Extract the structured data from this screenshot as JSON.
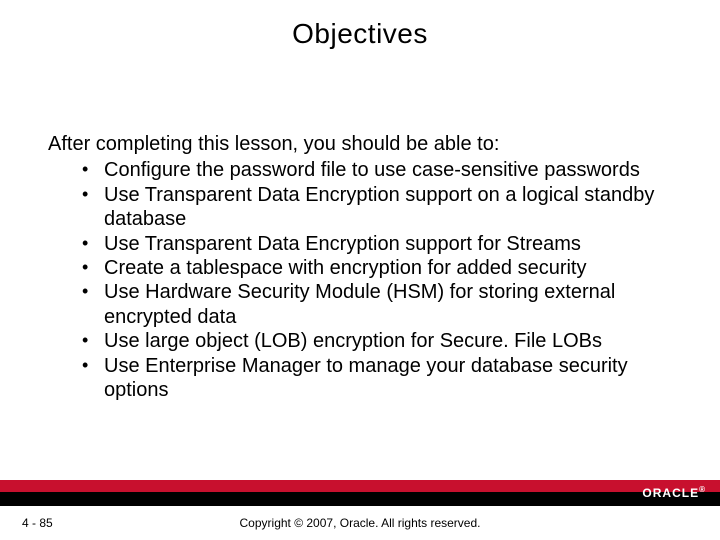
{
  "title": "Objectives",
  "intro": "After completing this lesson, you should be able to:",
  "bullets": [
    "Configure the password file to use case-sensitive passwords",
    "Use Transparent Data Encryption support on a logical standby database",
    "Use Transparent Data Encryption support for Streams",
    "Create a tablespace with encryption for added security",
    "Use Hardware Security Module (HSM) for storing external encrypted data",
    "Use large object (LOB) encryption for Secure. File LOBs",
    "Use Enterprise Manager to manage your database security options"
  ],
  "footer": {
    "page": "4 - 85",
    "copyright": "Copyright © 2007, Oracle. All rights reserved.",
    "logo_text": "ORACLE"
  }
}
